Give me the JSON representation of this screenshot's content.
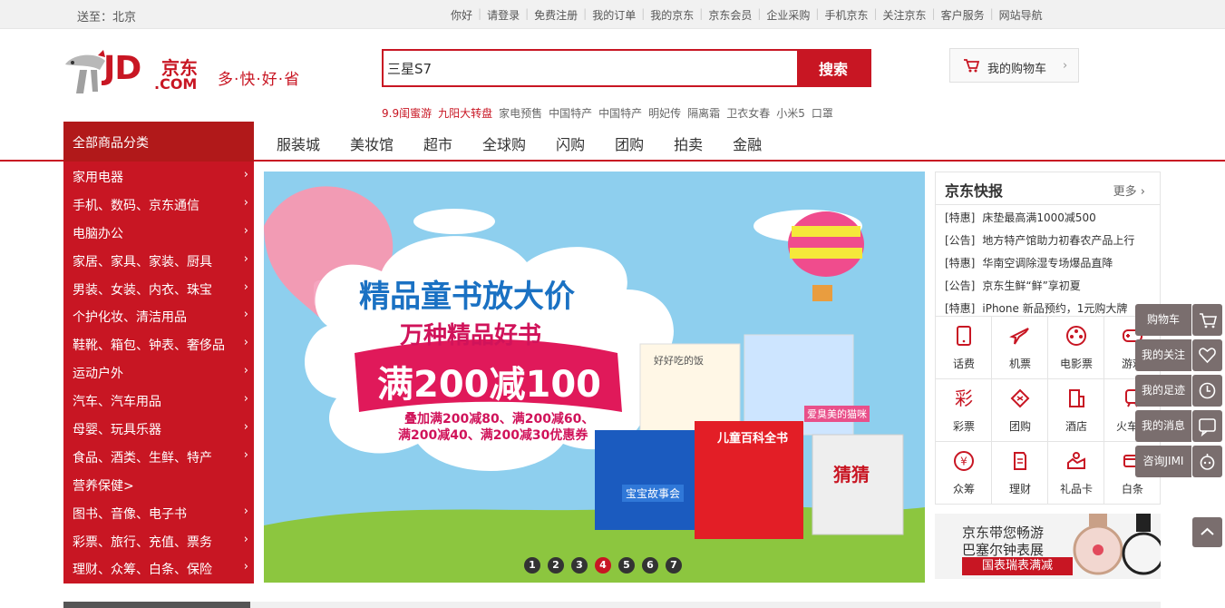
{
  "topbar": {
    "location": "送至：北京",
    "links": [
      "你好",
      "请登录",
      "免费注册",
      "我的订单",
      "我的京东",
      "京东会员",
      "企业采购",
      "手机京东",
      "关注京东",
      "客户服务",
      "网站导航"
    ]
  },
  "logo": {
    "brand_en": "JD",
    "brand_com": ".COM",
    "brand_cn": "京东",
    "slogan": "多·快·好·省"
  },
  "search": {
    "value": "三星S7",
    "button": "搜索"
  },
  "hotwords": [
    {
      "text": "9.9闺蜜游",
      "red": true
    },
    {
      "text": "九阳大转盘",
      "red": true
    },
    {
      "text": "家电预售",
      "red": false
    },
    {
      "text": "中国特产",
      "red": false
    },
    {
      "text": "中国特产",
      "red": false
    },
    {
      "text": "明妃传",
      "red": false
    },
    {
      "text": "隔离霜",
      "red": false
    },
    {
      "text": "卫衣女春",
      "red": false
    },
    {
      "text": "小米5",
      "red": false
    },
    {
      "text": "口罩",
      "red": false
    }
  ],
  "cart": {
    "label": "我的购物车"
  },
  "nav": {
    "all_categories": "全部商品分类",
    "items": [
      "服装城",
      "美妆馆",
      "超市",
      "全球购",
      "闪购",
      "团购",
      "拍卖",
      "金融"
    ]
  },
  "categories": [
    "家用电器",
    "手机、数码、京东通信",
    "电脑办公",
    "家居、家具、家装、厨具",
    "男装、女装、内衣、珠宝",
    "个护化妆、清洁用品",
    "鞋靴、箱包、钟表、奢侈品",
    "运动户外",
    "汽车、汽车用品",
    "母婴、玩具乐器",
    "食品、酒类、生鲜、特产",
    "营养保健>",
    "图书、音像、电子书",
    "彩票、旅行、充值、票务",
    "理财、众筹、白条、保险"
  ],
  "banner": {
    "title": "精品童书放大价",
    "subtitle": "万种精品好书",
    "offer": "满200减100",
    "detail_line1": "叠加满200减80、满200减60、",
    "detail_line2": "满200减40、满200减30优惠券",
    "book1": "好好吃的饭",
    "book2": "爱臭美的猫咪",
    "book3": "宝宝故事会",
    "book4": "儿童百科全书",
    "book5": "猜猜",
    "dots": [
      "1",
      "2",
      "3",
      "4",
      "5",
      "6",
      "7"
    ],
    "active_dot": 4
  },
  "news": {
    "title": "京东快报",
    "more": "更多",
    "items": [
      {
        "tag": "[特惠]",
        "text": "床垫最高满1000减500"
      },
      {
        "tag": "[公告]",
        "text": "地方特产馆助力初春农产品上行"
      },
      {
        "tag": "[特惠]",
        "text": "华南空调除湿专场爆品直降"
      },
      {
        "tag": "[公告]",
        "text": "京东生鲜“鲜”享初夏"
      },
      {
        "tag": "[特惠]",
        "text": "iPhone 新品预约，1元购大牌"
      }
    ]
  },
  "services": [
    {
      "label": "话费",
      "icon": "phone-icon"
    },
    {
      "label": "机票",
      "icon": "plane-icon"
    },
    {
      "label": "电影票",
      "icon": "film-icon"
    },
    {
      "label": "游戏",
      "icon": "game-icon"
    },
    {
      "label": "彩票",
      "icon": "lottery-icon"
    },
    {
      "label": "团购",
      "icon": "group-buy-icon"
    },
    {
      "label": "酒店",
      "icon": "hotel-icon"
    },
    {
      "label": "火车票",
      "icon": "train-icon"
    },
    {
      "label": "众筹",
      "icon": "crowdfund-icon"
    },
    {
      "label": "理财",
      "icon": "finance-icon"
    },
    {
      "label": "礼品卡",
      "icon": "gift-card-icon"
    },
    {
      "label": "白条",
      "icon": "credit-icon"
    }
  ],
  "ad_watch": {
    "line1": "京东带您畅游",
    "line2": "巴塞尔钟表展",
    "line3": "国表瑞表满减"
  },
  "toolbar": [
    "购物车",
    "我的关注",
    "我的足迹",
    "我的消息",
    "咨询JIMI"
  ],
  "colors": {
    "brand_red": "#c81623",
    "dark_red": "#b1191a",
    "toolbar_gray": "#7a6e6e"
  }
}
